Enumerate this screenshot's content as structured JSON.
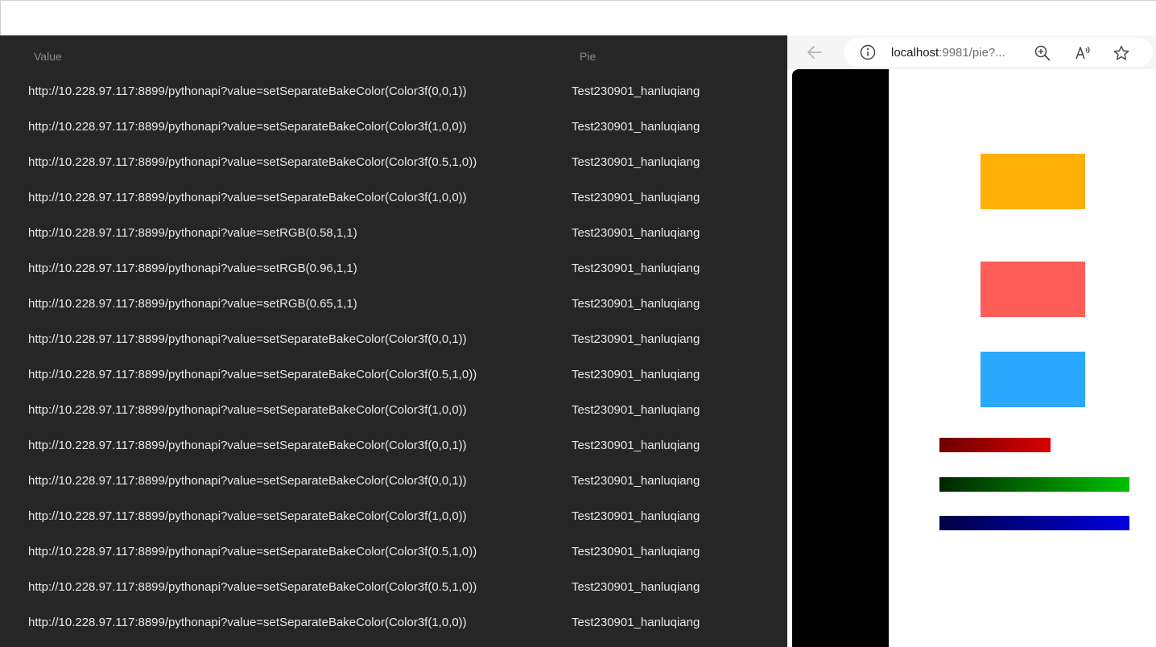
{
  "log_table": {
    "headers": {
      "value": "Value",
      "pie": "Pie"
    },
    "rows": [
      {
        "value": "http://10.228.97.117:8899/pythonapi?value=setSeparateBakeColor(Color3f(0,0,1))",
        "pie": "Test230901_hanluqiang"
      },
      {
        "value": "http://10.228.97.117:8899/pythonapi?value=setSeparateBakeColor(Color3f(1,0,0))",
        "pie": "Test230901_hanluqiang"
      },
      {
        "value": "http://10.228.97.117:8899/pythonapi?value=setSeparateBakeColor(Color3f(0.5,1,0))",
        "pie": "Test230901_hanluqiang"
      },
      {
        "value": "http://10.228.97.117:8899/pythonapi?value=setSeparateBakeColor(Color3f(1,0,0))",
        "pie": "Test230901_hanluqiang"
      },
      {
        "value": "http://10.228.97.117:8899/pythonapi?value=setRGB(0.58,1,1)",
        "pie": "Test230901_hanluqiang"
      },
      {
        "value": "http://10.228.97.117:8899/pythonapi?value=setRGB(0.96,1,1)",
        "pie": "Test230901_hanluqiang"
      },
      {
        "value": "http://10.228.97.117:8899/pythonapi?value=setRGB(0.65,1,1)",
        "pie": "Test230901_hanluqiang"
      },
      {
        "value": "http://10.228.97.117:8899/pythonapi?value=setSeparateBakeColor(Color3f(0,0,1))",
        "pie": "Test230901_hanluqiang"
      },
      {
        "value": "http://10.228.97.117:8899/pythonapi?value=setSeparateBakeColor(Color3f(0.5,1,0))",
        "pie": "Test230901_hanluqiang"
      },
      {
        "value": "http://10.228.97.117:8899/pythonapi?value=setSeparateBakeColor(Color3f(1,0,0))",
        "pie": "Test230901_hanluqiang"
      },
      {
        "value": "http://10.228.97.117:8899/pythonapi?value=setSeparateBakeColor(Color3f(0,0,1))",
        "pie": "Test230901_hanluqiang"
      },
      {
        "value": "http://10.228.97.117:8899/pythonapi?value=setSeparateBakeColor(Color3f(0,0,1))",
        "pie": "Test230901_hanluqiang"
      },
      {
        "value": "http://10.228.97.117:8899/pythonapi?value=setSeparateBakeColor(Color3f(1,0,0))",
        "pie": "Test230901_hanluqiang"
      },
      {
        "value": "http://10.228.97.117:8899/pythonapi?value=setSeparateBakeColor(Color3f(0.5,1,0))",
        "pie": "Test230901_hanluqiang"
      },
      {
        "value": "http://10.228.97.117:8899/pythonapi?value=setSeparateBakeColor(Color3f(0.5,1,0))",
        "pie": "Test230901_hanluqiang"
      },
      {
        "value": "http://10.228.97.117:8899/pythonapi?value=setSeparateBakeColor(Color3f(1,0,0))",
        "pie": "Test230901_hanluqiang"
      }
    ]
  },
  "browser": {
    "url_host": "localhost",
    "url_rest": ":9981/pie?...",
    "icons": [
      "back-arrow-icon",
      "info-icon",
      "zoom-icon",
      "read-aloud-icon",
      "favorite-star-icon"
    ]
  },
  "preview": {
    "swatch_colors": [
      "#ffb007",
      "#fe5e57",
      "#29a8fe"
    ],
    "gradient_bars": [
      {
        "from": "#6e0000",
        "to": "#d90000"
      },
      {
        "from": "#002500",
        "to": "#00c000"
      },
      {
        "from": "#000045",
        "to": "#0000e0"
      }
    ]
  }
}
